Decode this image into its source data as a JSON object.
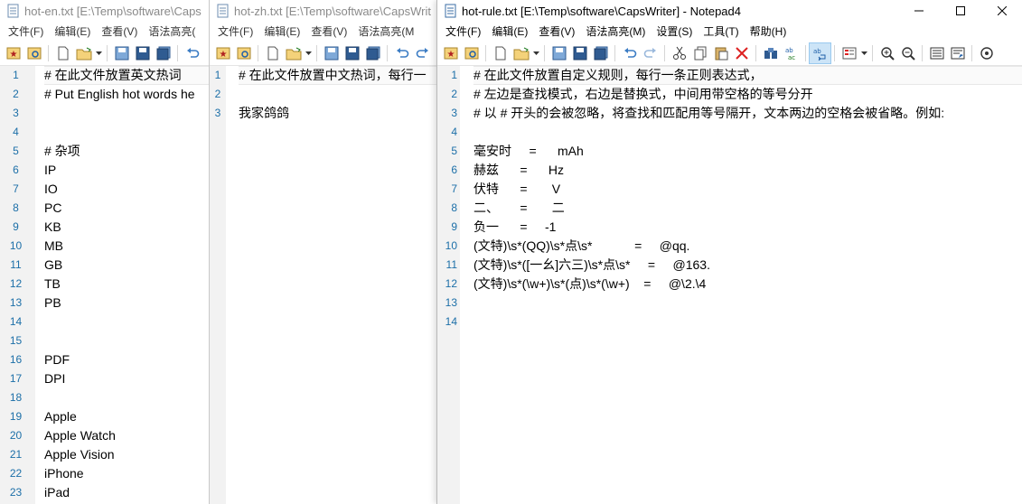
{
  "windows": [
    {
      "title": "hot-en.txt [E:\\Temp\\software\\Caps",
      "menu": [
        "文件(F)",
        "编辑(E)",
        "查看(V)",
        "语法高亮("
      ],
      "line_numbers": [
        "1",
        "2",
        "3",
        "4",
        "5",
        "6",
        "7",
        "8",
        "9",
        "10",
        "11",
        "12",
        "13",
        "14",
        "15",
        "16",
        "17",
        "18",
        "19",
        "20",
        "21",
        "22",
        "23"
      ],
      "lines": [
        "# 在此文件放置英文热词",
        "# Put English hot words he",
        "",
        "",
        "# 杂项",
        "IP",
        "IO",
        "PC",
        "KB",
        "MB",
        "GB",
        "TB",
        "PB",
        "",
        "",
        "PDF",
        "DPI",
        "",
        "Apple",
        "Apple Watch",
        "Apple Vision",
        "iPhone",
        "iPad"
      ]
    },
    {
      "title": "hot-zh.txt [E:\\Temp\\software\\CapsWrit",
      "menu": [
        "文件(F)",
        "编辑(E)",
        "查看(V)",
        "语法高亮(M"
      ],
      "line_numbers": [
        "1",
        "2",
        "3"
      ],
      "lines": [
        "# 在此文件放置中文热词，每行一",
        "",
        "我家鸽鸽"
      ]
    },
    {
      "title": "hot-rule.txt [E:\\Temp\\software\\CapsWriter] - Notepad4",
      "menu": [
        "文件(F)",
        "编辑(E)",
        "查看(V)",
        "语法高亮(M)",
        "设置(S)",
        "工具(T)",
        "帮助(H)"
      ],
      "line_numbers": [
        "1",
        "2",
        "3",
        "4",
        "5",
        "6",
        "7",
        "8",
        "9",
        "10",
        "11",
        "12",
        "13",
        "14"
      ],
      "lines": [
        "# 在此文件放置自定义规则，每行一条正则表达式，",
        "# 左边是查找模式，右边是替换式，中间用带空格的等号分开",
        "# 以 # 开头的会被忽略，将查找和匹配用等号隔开，文本两边的空格会被省略。例如:",
        "",
        "毫安时     =      mAh",
        "赫兹      =      Hz",
        "伏特      =       V",
        "二、      =       二",
        "负一      =     -1",
        "(文特)\\s*(QQ)\\s*点\\s*            =     @qq.",
        "(文特)\\s*([一幺]六三)\\s*点\\s*     =     @163.",
        "(文特)\\s*(\\w+)\\s*(点)\\s*(\\w+)    =     @\\2.\\4",
        "",
        ""
      ]
    }
  ],
  "icons": {
    "toolbar": [
      "favorites-icon",
      "open-favorites-icon",
      "new-file-icon",
      "open-folder-icon",
      "save-icon",
      "save-as-icon",
      "save-copy-icon",
      "undo-icon",
      "redo-icon",
      "cut-icon",
      "copy-icon",
      "paste-icon",
      "delete-icon",
      "find-icon",
      "replace-icon",
      "word-wrap-icon",
      "scheme-icon",
      "zoom-in-icon",
      "zoom-out-icon",
      "line-numbers-icon",
      "settings-icon"
    ],
    "window_controls": [
      "minimize-icon",
      "maximize-icon",
      "close-icon"
    ]
  },
  "colors": {
    "line_number": "#1c6fa8",
    "gutter": "#f2f2f2",
    "active_button": "#cce4f7"
  }
}
